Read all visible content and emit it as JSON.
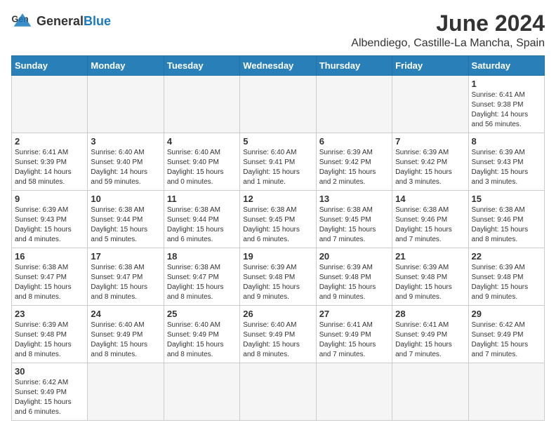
{
  "header": {
    "logo_general": "General",
    "logo_blue": "Blue",
    "month": "June 2024",
    "location": "Albendiego, Castille-La Mancha, Spain"
  },
  "days_of_week": [
    "Sunday",
    "Monday",
    "Tuesday",
    "Wednesday",
    "Thursday",
    "Friday",
    "Saturday"
  ],
  "weeks": [
    [
      {
        "day": "",
        "info": ""
      },
      {
        "day": "",
        "info": ""
      },
      {
        "day": "",
        "info": ""
      },
      {
        "day": "",
        "info": ""
      },
      {
        "day": "",
        "info": ""
      },
      {
        "day": "",
        "info": ""
      },
      {
        "day": "1",
        "info": "Sunrise: 6:41 AM\nSunset: 9:38 PM\nDaylight: 14 hours and 56 minutes."
      }
    ],
    [
      {
        "day": "2",
        "info": "Sunrise: 6:41 AM\nSunset: 9:39 PM\nDaylight: 14 hours and 58 minutes."
      },
      {
        "day": "3",
        "info": "Sunrise: 6:40 AM\nSunset: 9:40 PM\nDaylight: 14 hours and 59 minutes."
      },
      {
        "day": "4",
        "info": "Sunrise: 6:40 AM\nSunset: 9:40 PM\nDaylight: 15 hours and 0 minutes."
      },
      {
        "day": "5",
        "info": "Sunrise: 6:40 AM\nSunset: 9:41 PM\nDaylight: 15 hours and 1 minute."
      },
      {
        "day": "6",
        "info": "Sunrise: 6:39 AM\nSunset: 9:42 PM\nDaylight: 15 hours and 2 minutes."
      },
      {
        "day": "7",
        "info": "Sunrise: 6:39 AM\nSunset: 9:42 PM\nDaylight: 15 hours and 3 minutes."
      },
      {
        "day": "8",
        "info": "Sunrise: 6:39 AM\nSunset: 9:43 PM\nDaylight: 15 hours and 3 minutes."
      }
    ],
    [
      {
        "day": "9",
        "info": "Sunrise: 6:39 AM\nSunset: 9:43 PM\nDaylight: 15 hours and 4 minutes."
      },
      {
        "day": "10",
        "info": "Sunrise: 6:38 AM\nSunset: 9:44 PM\nDaylight: 15 hours and 5 minutes."
      },
      {
        "day": "11",
        "info": "Sunrise: 6:38 AM\nSunset: 9:44 PM\nDaylight: 15 hours and 6 minutes."
      },
      {
        "day": "12",
        "info": "Sunrise: 6:38 AM\nSunset: 9:45 PM\nDaylight: 15 hours and 6 minutes."
      },
      {
        "day": "13",
        "info": "Sunrise: 6:38 AM\nSunset: 9:45 PM\nDaylight: 15 hours and 7 minutes."
      },
      {
        "day": "14",
        "info": "Sunrise: 6:38 AM\nSunset: 9:46 PM\nDaylight: 15 hours and 7 minutes."
      },
      {
        "day": "15",
        "info": "Sunrise: 6:38 AM\nSunset: 9:46 PM\nDaylight: 15 hours and 8 minutes."
      }
    ],
    [
      {
        "day": "16",
        "info": "Sunrise: 6:38 AM\nSunset: 9:47 PM\nDaylight: 15 hours and 8 minutes."
      },
      {
        "day": "17",
        "info": "Sunrise: 6:38 AM\nSunset: 9:47 PM\nDaylight: 15 hours and 8 minutes."
      },
      {
        "day": "18",
        "info": "Sunrise: 6:38 AM\nSunset: 9:47 PM\nDaylight: 15 hours and 8 minutes."
      },
      {
        "day": "19",
        "info": "Sunrise: 6:39 AM\nSunset: 9:48 PM\nDaylight: 15 hours and 9 minutes."
      },
      {
        "day": "20",
        "info": "Sunrise: 6:39 AM\nSunset: 9:48 PM\nDaylight: 15 hours and 9 minutes."
      },
      {
        "day": "21",
        "info": "Sunrise: 6:39 AM\nSunset: 9:48 PM\nDaylight: 15 hours and 9 minutes."
      },
      {
        "day": "22",
        "info": "Sunrise: 6:39 AM\nSunset: 9:48 PM\nDaylight: 15 hours and 9 minutes."
      }
    ],
    [
      {
        "day": "23",
        "info": "Sunrise: 6:39 AM\nSunset: 9:48 PM\nDaylight: 15 hours and 8 minutes."
      },
      {
        "day": "24",
        "info": "Sunrise: 6:40 AM\nSunset: 9:49 PM\nDaylight: 15 hours and 8 minutes."
      },
      {
        "day": "25",
        "info": "Sunrise: 6:40 AM\nSunset: 9:49 PM\nDaylight: 15 hours and 8 minutes."
      },
      {
        "day": "26",
        "info": "Sunrise: 6:40 AM\nSunset: 9:49 PM\nDaylight: 15 hours and 8 minutes."
      },
      {
        "day": "27",
        "info": "Sunrise: 6:41 AM\nSunset: 9:49 PM\nDaylight: 15 hours and 7 minutes."
      },
      {
        "day": "28",
        "info": "Sunrise: 6:41 AM\nSunset: 9:49 PM\nDaylight: 15 hours and 7 minutes."
      },
      {
        "day": "29",
        "info": "Sunrise: 6:42 AM\nSunset: 9:49 PM\nDaylight: 15 hours and 7 minutes."
      }
    ],
    [
      {
        "day": "30",
        "info": "Sunrise: 6:42 AM\nSunset: 9:49 PM\nDaylight: 15 hours and 6 minutes."
      },
      {
        "day": "",
        "info": ""
      },
      {
        "day": "",
        "info": ""
      },
      {
        "day": "",
        "info": ""
      },
      {
        "day": "",
        "info": ""
      },
      {
        "day": "",
        "info": ""
      },
      {
        "day": "",
        "info": ""
      }
    ]
  ]
}
